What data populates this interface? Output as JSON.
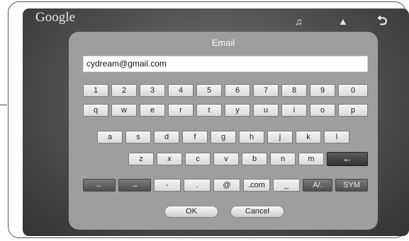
{
  "header": {
    "brand": "Google",
    "icons": [
      "volume-icon",
      "home-icon",
      "return-icon"
    ],
    "return_glyph": "⮌"
  },
  "dialog": {
    "title": "Email",
    "input_value": "cydream@gmail.com",
    "ok_label": "OK",
    "cancel_label": "Cancel"
  },
  "keyboard": {
    "row1": [
      "1",
      "2",
      "3",
      "4",
      "5",
      "6",
      "7",
      "8",
      "9",
      "0"
    ],
    "row2": [
      "q",
      "w",
      "e",
      "r",
      "t",
      "y",
      "u",
      "i",
      "o",
      "p"
    ],
    "row3": [
      "a",
      "s",
      "d",
      "f",
      "g",
      "h",
      "j",
      "k",
      "l"
    ],
    "row4": [
      "z",
      "x",
      "c",
      "v",
      "b",
      "n",
      "m"
    ],
    "backspace": "←",
    "row5": [
      "←",
      "→",
      "-",
      ".",
      "@",
      ".com",
      "_",
      "A/.",
      "SYM"
    ]
  },
  "colors": {
    "accent_dark_key": "#555555",
    "panel": "#9e9e9e"
  }
}
